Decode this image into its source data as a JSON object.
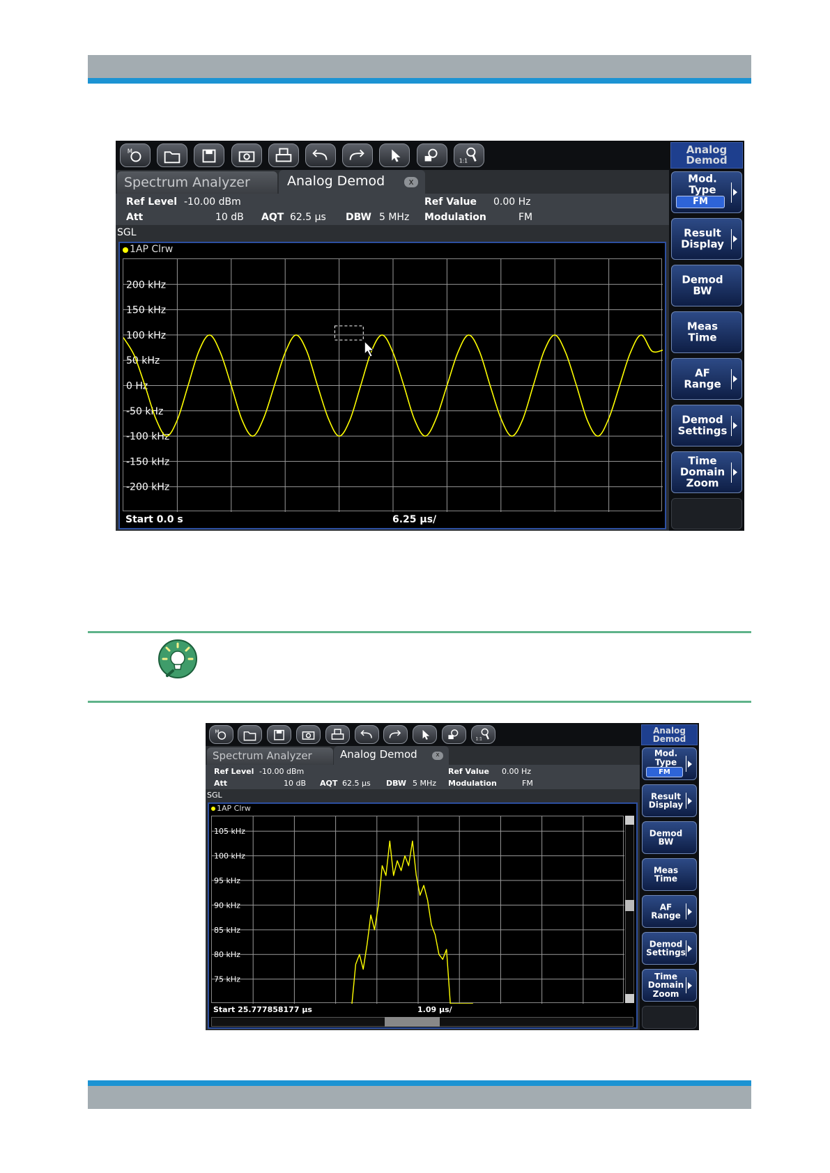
{
  "header": {
    "bar_color": "#a3acb1",
    "accent_color": "#1c93d3"
  },
  "footer": {
    "bar_color": "#a3acb1",
    "accent_color": "#1c93d3"
  },
  "tip": {
    "line_color": "#5fb38a",
    "icon": "lightbulb-icon"
  },
  "toolbar_icons": [
    "preset-icon",
    "open-icon",
    "save-icon",
    "camera-icon",
    "print-icon",
    "undo-icon",
    "redo-icon",
    "pointer-icon",
    "zoom-multi-icon",
    "zoom-icon"
  ],
  "screen1": {
    "softkey_header": "Analog Demod",
    "tabs": {
      "inactive": "Spectrum Analyzer",
      "active": "Analog Demod",
      "close": "x"
    },
    "info": {
      "ref_level_label": "Ref Level",
      "ref_level_value": "-10.00 dBm",
      "att_label": "Att",
      "att_value": "10 dB",
      "aqt_label": "AQT",
      "aqt_value": "62.5 µs",
      "dbw_label": "DBW",
      "dbw_value": "5 MHz",
      "ref_value_label": "Ref Value",
      "ref_value_value": "0.00 Hz",
      "modulation_label": "Modulation",
      "modulation_value": "FM",
      "sgl": "SGL",
      "trace": "1AP Clrw"
    },
    "softkeys": [
      {
        "label": "Mod. Type",
        "sub": "FM",
        "arrow": true
      },
      {
        "label": "Result Display",
        "arrow": true
      },
      {
        "label": "Demod BW",
        "arrow": false
      },
      {
        "label": "Meas Time",
        "arrow": false
      },
      {
        "label": "AF Range",
        "arrow": true
      },
      {
        "label": "Demod Settings",
        "arrow": true
      },
      {
        "label": "Time Domain Zoom",
        "arrow": true
      }
    ],
    "start": "Start 0.0 s",
    "div": "6.25 µs/"
  },
  "screen2": {
    "softkey_header": "Analog Demod",
    "tabs": {
      "inactive": "Spectrum Analyzer",
      "active": "Analog Demod",
      "close": "x"
    },
    "info": {
      "ref_level_label": "Ref Level",
      "ref_level_value": "-10.00 dBm",
      "att_label": "Att",
      "att_value": "10 dB",
      "aqt_label": "AQT",
      "aqt_value": "62.5 µs",
      "dbw_label": "DBW",
      "dbw_value": "5 MHz",
      "ref_value_label": "Ref Value",
      "ref_value_value": "0.00 Hz",
      "modulation_label": "Modulation",
      "modulation_value": "FM",
      "sgl": "SGL",
      "trace": "1AP Clrw"
    },
    "softkeys": [
      {
        "label": "Mod. Type",
        "sub": "FM",
        "arrow": true
      },
      {
        "label": "Result Display",
        "arrow": true
      },
      {
        "label": "Demod BW",
        "arrow": false
      },
      {
        "label": "Meas Time",
        "arrow": false
      },
      {
        "label": "AF Range",
        "arrow": true
      },
      {
        "label": "Demod Settings",
        "arrow": true
      },
      {
        "label": "Time Domain Zoom",
        "arrow": true
      }
    ],
    "start": "Start 25.777858177 µs",
    "div": "1.09 µs/"
  },
  "chart_data": [
    {
      "type": "line",
      "ylabel": "",
      "xlabel": "",
      "yticks": [
        "200 kHz",
        "150 kHz",
        "100 kHz",
        "50 kHz",
        "0 Hz",
        "-50 kHz",
        "-100 kHz",
        "-150 kHz",
        "-200 kHz"
      ],
      "ylim": [
        -250,
        250
      ],
      "xlim": [
        0,
        62.5
      ],
      "grid": true,
      "trace_color": "#ffff00",
      "series": [
        {
          "x_unit": "µs",
          "y_unit": "kHz",
          "x": [
            0,
            1.25,
            2.5,
            3.75,
            5.0,
            6.25,
            7.5,
            8.75,
            10.0,
            11.25,
            12.5,
            13.75,
            15.0,
            16.25,
            17.5,
            18.75,
            20.0,
            21.25,
            22.5,
            23.75,
            25.0,
            26.25,
            27.5,
            28.75,
            30.0,
            31.25,
            32.5,
            33.75,
            35.0,
            36.25,
            37.5,
            38.75,
            40.0,
            41.25,
            42.5,
            43.75,
            45.0,
            46.25,
            47.5,
            48.75,
            50.0,
            51.25,
            52.5,
            53.75,
            55.0,
            56.25,
            57.5,
            58.75,
            60.0,
            61.25,
            62.5
          ],
          "y": [
            95,
            60,
            0,
            -65,
            -100,
            -68,
            0,
            68,
            100,
            65,
            0,
            -68,
            -100,
            -65,
            0,
            65,
            100,
            68,
            0,
            -65,
            -100,
            -68,
            0,
            68,
            100,
            65,
            0,
            -68,
            -100,
            -65,
            0,
            65,
            100,
            68,
            0,
            -65,
            -100,
            -68,
            0,
            68,
            100,
            65,
            0,
            -68,
            -100,
            -65,
            0,
            65,
            100,
            68,
            70
          ]
        }
      ]
    },
    {
      "type": "line",
      "ylabel": "",
      "xlabel": "",
      "yticks": [
        "105 kHz",
        "100 kHz",
        "95 kHz",
        "90 kHz",
        "85 kHz",
        "80 kHz",
        "75 kHz"
      ],
      "ylim": [
        70,
        108
      ],
      "xlim": [
        0,
        10.9
      ],
      "grid": true,
      "trace_color": "#ffff00",
      "series": [
        {
          "x_unit": "µs",
          "y_unit": "kHz",
          "x": [
            3.7,
            3.8,
            3.9,
            4.0,
            4.1,
            4.2,
            4.3,
            4.4,
            4.5,
            4.6,
            4.7,
            4.8,
            4.9,
            5.0,
            5.1,
            5.2,
            5.3,
            5.4,
            5.5,
            5.6,
            5.7,
            5.8,
            5.9,
            6.0,
            6.1,
            6.2,
            6.3,
            6.4,
            6.5,
            6.6,
            6.7,
            6.8,
            6.9
          ],
          "y": [
            70,
            78,
            80,
            77,
            82,
            88,
            85,
            90,
            98,
            96,
            103,
            96,
            99,
            97,
            100,
            98,
            103,
            96,
            92,
            94,
            91,
            86,
            84,
            80,
            79,
            81,
            70,
            70,
            70,
            70,
            70,
            70,
            70
          ]
        }
      ]
    }
  ]
}
